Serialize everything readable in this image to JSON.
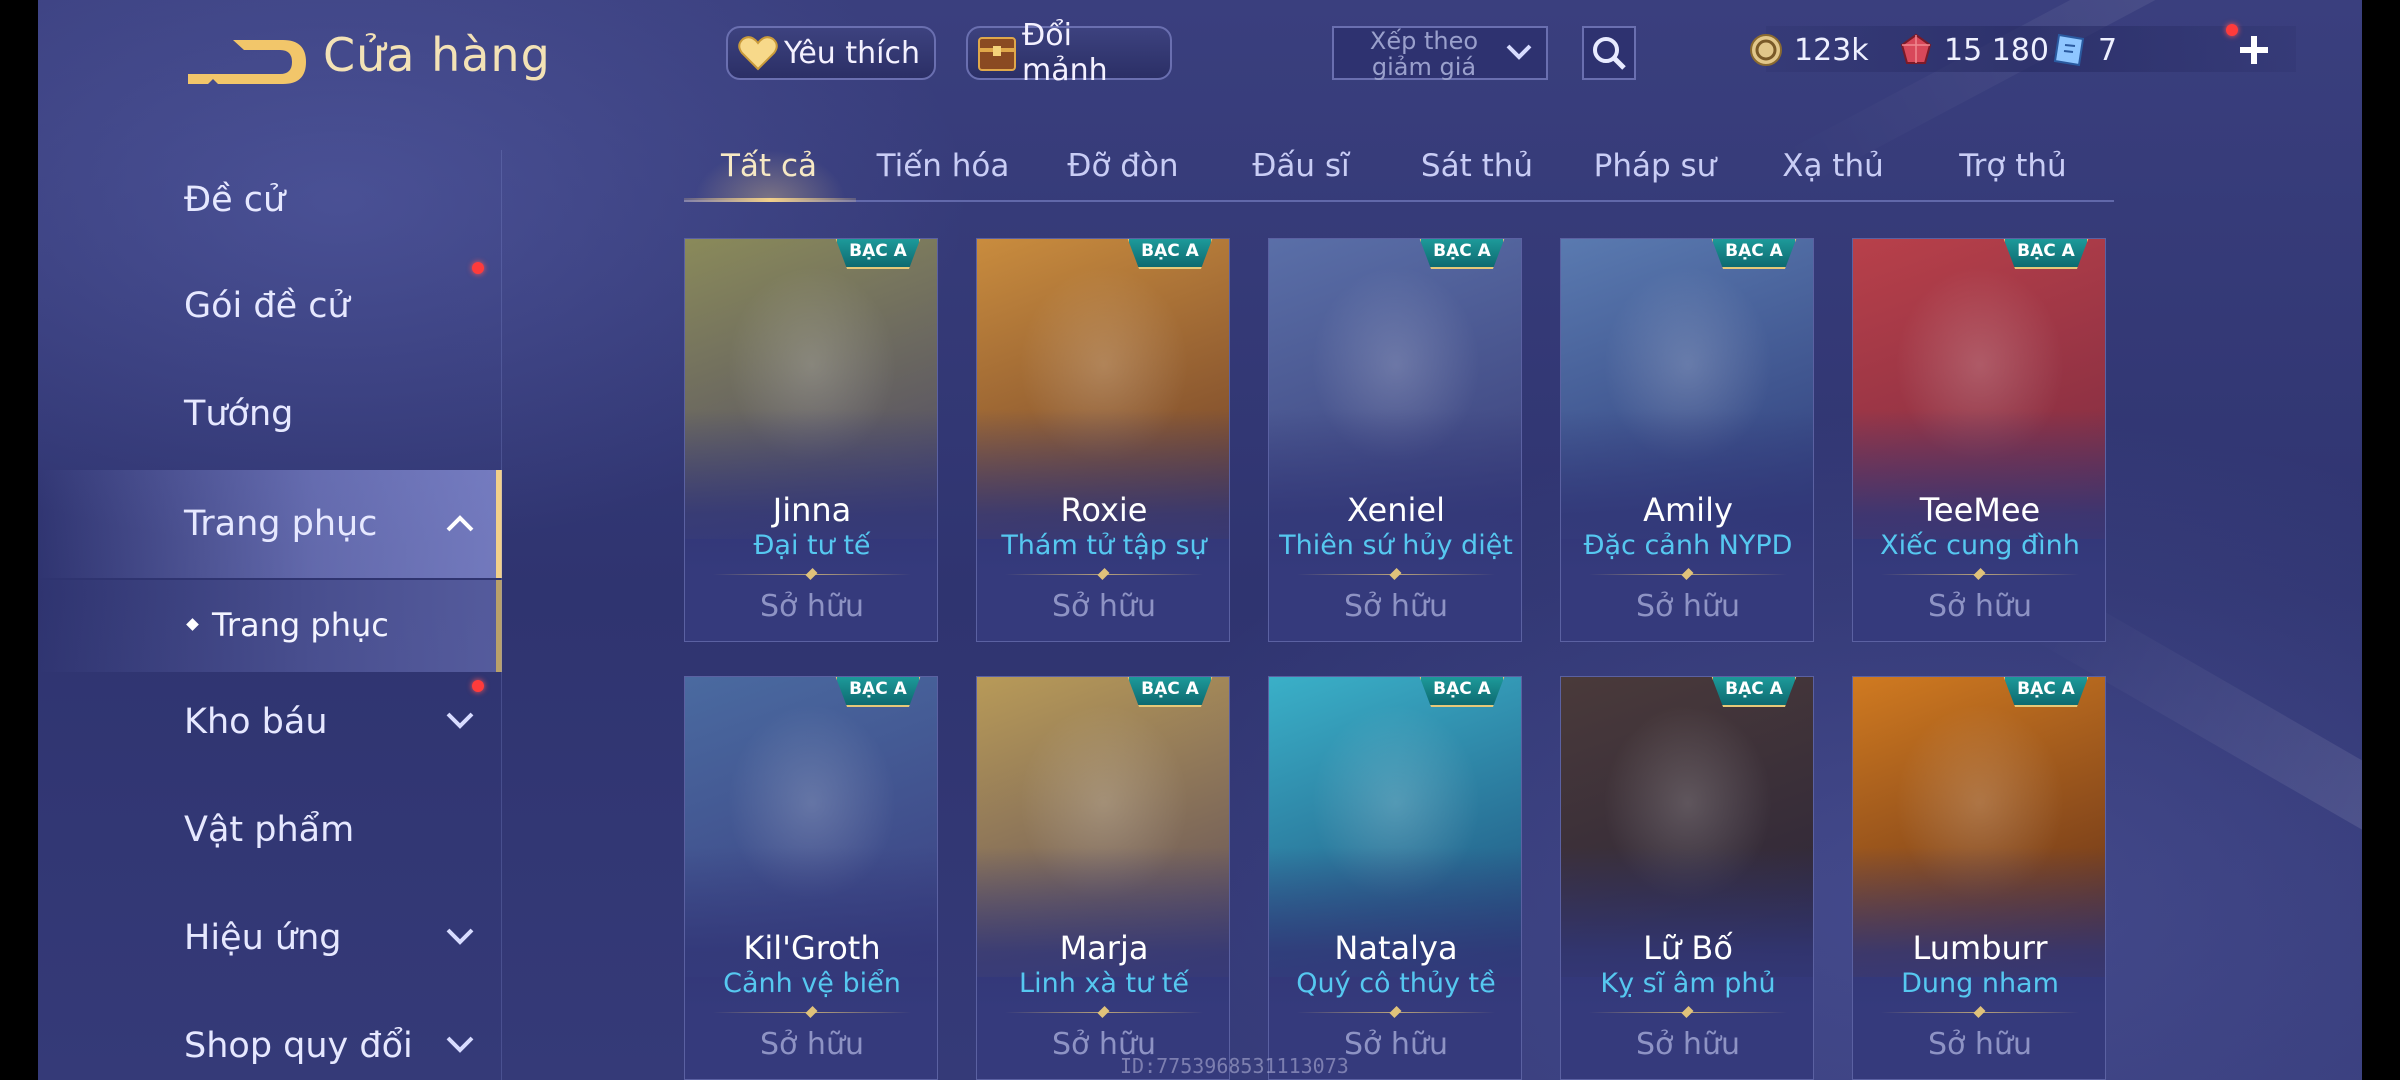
{
  "header": {
    "title": "Cửa hàng",
    "favorites_label": "Yêu thích",
    "shards_label": "Đổi mảnh",
    "sort_label": "Xếp theo giảm giá",
    "currencies": [
      {
        "icon": "gold-coin-icon",
        "value": "123k"
      },
      {
        "icon": "red-gem-icon",
        "value": "15 180"
      },
      {
        "icon": "ticket-icon",
        "value": "7"
      }
    ]
  },
  "sidebar": {
    "items": [
      {
        "label": "Đề cử"
      },
      {
        "label": "Gói đề cử"
      },
      {
        "label": "Tướng"
      },
      {
        "label": "Trang phục"
      },
      {
        "label": "Trang phục"
      },
      {
        "label": "Kho báu"
      },
      {
        "label": "Vật phẩm"
      },
      {
        "label": "Hiệu ứng"
      },
      {
        "label": "Shop quy đổi"
      }
    ]
  },
  "tabs": [
    {
      "label": "Tất cả",
      "active": true
    },
    {
      "label": "Tiến hóa"
    },
    {
      "label": "Đỡ đòn"
    },
    {
      "label": "Đấu sĩ"
    },
    {
      "label": "Sát thủ"
    },
    {
      "label": "Pháp sư"
    },
    {
      "label": "Xạ thủ"
    },
    {
      "label": "Trợ thủ"
    }
  ],
  "cards": [
    {
      "badge": "BẠC A",
      "hero": "Jinna",
      "skin": "Đại tư tế",
      "status": "Sở hữu",
      "color_top": "#8a8a5a",
      "color_bottom": "#4a4466"
    },
    {
      "badge": "BẠC A",
      "hero": "Roxie",
      "skin": "Thám tử tập sự",
      "status": "Sở hữu",
      "color_top": "#c98c3e",
      "color_bottom": "#6a3c28"
    },
    {
      "badge": "BẠC A",
      "hero": "Xeniel",
      "skin": "Thiên sứ hủy diệt",
      "status": "Sở hữu",
      "color_top": "#5a6fa8",
      "color_bottom": "#3a3e78"
    },
    {
      "badge": "BẠC A",
      "hero": "Amily",
      "skin": "Đặc cảnh NYPD",
      "status": "Sở hữu",
      "color_top": "#5a7ab0",
      "color_bottom": "#2d3b78"
    },
    {
      "badge": "BẠC A",
      "hero": "TeeMee",
      "skin": "Xiếc cung đình",
      "status": "Sở hữu",
      "color_top": "#b8404a",
      "color_bottom": "#7a2a40"
    },
    {
      "badge": "BẠC A",
      "hero": "Kil'Groth",
      "skin": "Cảnh vệ biển",
      "status": "Sở hữu",
      "color_top": "#4a6aa0",
      "color_bottom": "#3a3e80"
    },
    {
      "badge": "BẠC A",
      "hero": "Marja",
      "skin": "Linh xà tư tế",
      "status": "Sở hữu",
      "color_top": "#b89a58",
      "color_bottom": "#5a4a5a"
    },
    {
      "badge": "BẠC A",
      "hero": "Natalya",
      "skin": "Quý cô thủy tề",
      "status": "Sở hữu",
      "color_top": "#3ab0c8",
      "color_bottom": "#1e4a78"
    },
    {
      "badge": "BẠC A",
      "hero": "Lữ Bố",
      "skin": "Kỵ sĩ âm phủ",
      "status": "Sở hữu",
      "color_top": "#4a3a3a",
      "color_bottom": "#2a2438"
    },
    {
      "badge": "BẠC A",
      "hero": "Lumburr",
      "skin": "Dung nham",
      "status": "Sở hữu",
      "color_top": "#d07a20",
      "color_bottom": "#5a2a18"
    }
  ],
  "watermark": "ID:7753968531113073",
  "colors": {
    "accent_gold": "#f2d08a",
    "skin_name_blue": "#56c8f0",
    "badge_teal": "#1e9d9d",
    "notification_red": "#ff3b3b"
  }
}
